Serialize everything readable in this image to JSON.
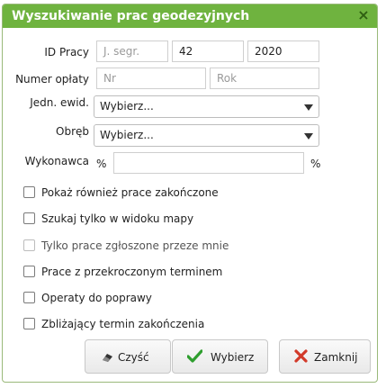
{
  "dialog": {
    "title": "Wyszukiwanie prac geodezyjnych",
    "close_icon": "close-icon"
  },
  "form": {
    "id_pracy": {
      "label": "ID Pracy",
      "segment_placeholder": "J. segr.",
      "number_value": "42",
      "year_value": "2020"
    },
    "numer_oplaty": {
      "label": "Numer opłaty",
      "nr_placeholder": "Nr",
      "rok_placeholder": "Rok"
    },
    "jedn_ewid": {
      "label": "Jedn. ewid.",
      "selected": "Wybierz..."
    },
    "obreb": {
      "label": "Obręb",
      "selected": "Wybierz..."
    },
    "wykonawca": {
      "label": "Wykonawca",
      "prefix": "%",
      "value": "",
      "suffix": "%"
    }
  },
  "checkboxes": [
    {
      "label": "Pokaż również prace zakończone",
      "checked": false,
      "enabled": true
    },
    {
      "label": "Szukaj tylko w widoku mapy",
      "checked": false,
      "enabled": true
    },
    {
      "label": "Tylko prace zgłoszone przeze mnie",
      "checked": false,
      "enabled": false
    },
    {
      "label": "Prace z przekroczonym terminem",
      "checked": false,
      "enabled": true
    },
    {
      "label": "Operaty do poprawy",
      "checked": false,
      "enabled": true
    },
    {
      "label": "Zbliżający termin zakończenia",
      "checked": false,
      "enabled": true
    }
  ],
  "buttons": {
    "clear": {
      "label": "Czyść",
      "icon": "eraser-icon"
    },
    "select": {
      "label": "Wybierz",
      "icon": "checkmark-icon",
      "icon_color": "#2e9e2e"
    },
    "close": {
      "label": "Zamknij",
      "icon": "close-x-icon",
      "icon_color": "#d23a2a"
    }
  },
  "colors": {
    "titlebar": "#6fb33f"
  }
}
